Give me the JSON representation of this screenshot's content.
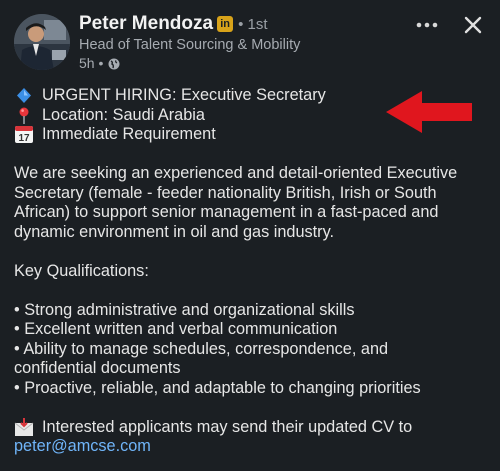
{
  "author": {
    "name": "Peter Mendoza",
    "badge": "in",
    "degree": "• 1st",
    "headline": "Head of Talent Sourcing & Mobility",
    "timestamp": "5h •",
    "visibility_icon": "globe-icon"
  },
  "actions": {
    "more_icon": "more-dots-icon",
    "close_icon": "close-icon"
  },
  "post": {
    "headline_lines": [
      {
        "icon": "blue-diamond-icon",
        "text": "URGENT HIRING: Executive Secretary"
      },
      {
        "icon": "location-pin-icon",
        "text": "Location: Saudi Arabia"
      },
      {
        "icon": "calendar-icon",
        "calendar_day": "17",
        "text": "Immediate Requirement"
      }
    ],
    "intro": "We are seeking an experienced and detail-oriented Executive Secretary (female - feeder nationality British, Irish or South African) to support senior management in a fast-paced and dynamic environment in oil and gas industry.",
    "qualifications_title": "Key Qualifications:",
    "bullets": [
      "• Strong administrative and organizational skills",
      "• Excellent written and verbal communication",
      "• Ability to manage schedules, correspondence, and confidential documents",
      "• Proactive, reliable, and adaptable to changing priorities"
    ],
    "cta_icon": "envelope-icon",
    "cta_text": "Interested applicants may send their updated CV to",
    "email": "peter@amcse.com"
  },
  "colors": {
    "background": "#1b1f23",
    "link": "#70b5f9",
    "arrow": "#e0161e",
    "linkedin_badge": "#d8a31a"
  }
}
